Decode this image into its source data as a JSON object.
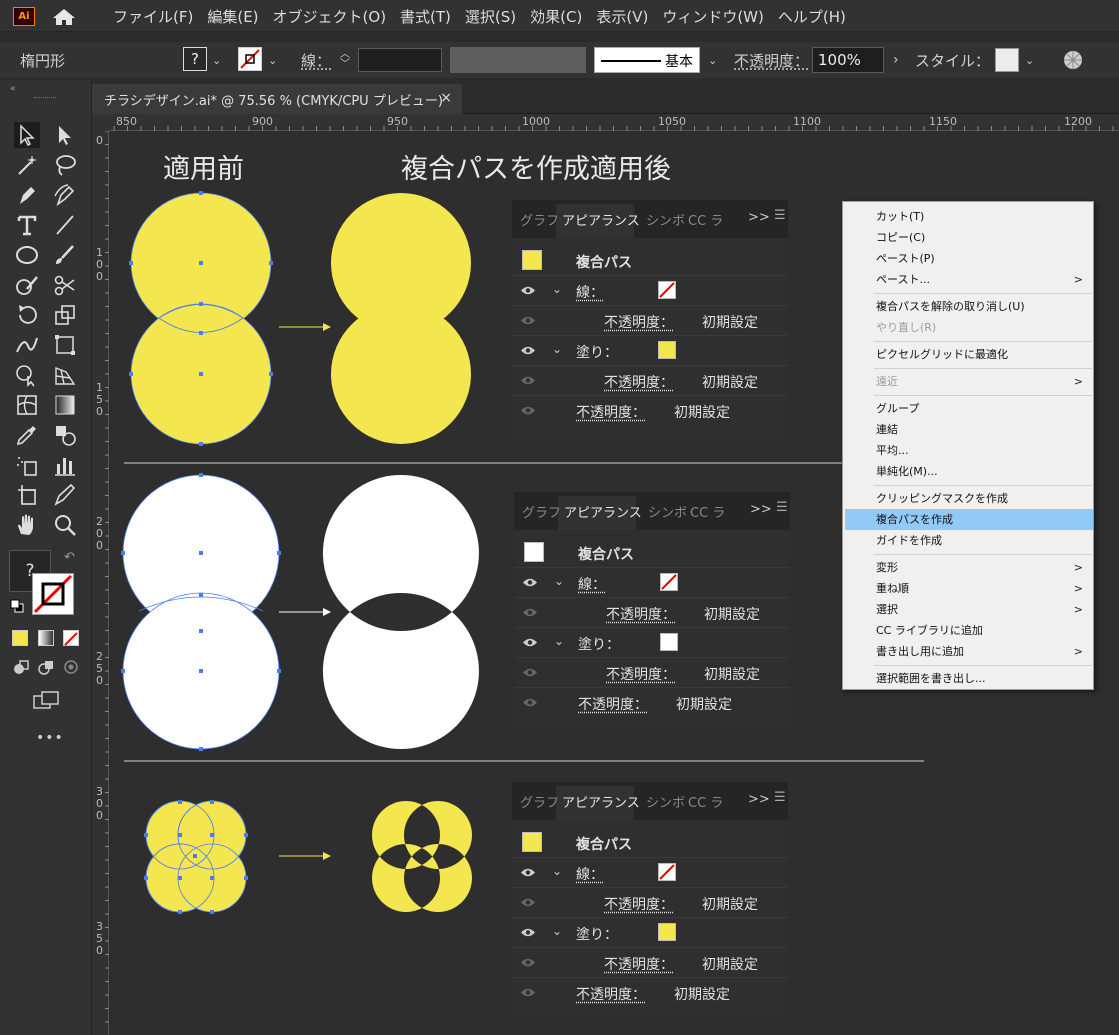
{
  "menubar": {
    "logo": "Ai",
    "items": [
      "ファイル(F)",
      "編集(E)",
      "オブジェクト(O)",
      "書式(T)",
      "選択(S)",
      "効果(C)",
      "表示(V)",
      "ウィンドウ(W)",
      "ヘルプ(H)"
    ]
  },
  "controlbar": {
    "selection_type": "楕円形",
    "fill_unknown": "?",
    "stroke_label": "線：",
    "brush_label": "基本",
    "opacity_label": "不透明度：",
    "opacity_value": "100%",
    "style_label": "スタイル："
  },
  "document_tab": {
    "title": "チラシデザイン.ai* @ 75.56 % (CMYK/CPU プレビュー)",
    "close": "×"
  },
  "ruler": {
    "top_ticks": [
      "850",
      "900",
      "950",
      "1000",
      "1050",
      "1100",
      "1150",
      "1200"
    ],
    "left_ticks": [
      [
        "0"
      ],
      [
        "1",
        "0",
        "0"
      ],
      [
        "1",
        "5",
        "0"
      ],
      [
        "2",
        "0",
        "0"
      ],
      [
        "2",
        "5",
        "0"
      ],
      [
        "3",
        "0",
        "0"
      ],
      [
        "3",
        "5",
        "0"
      ]
    ]
  },
  "toolbar": {
    "fill_unknown": "?",
    "more": "•••"
  },
  "canvas": {
    "heading_before": "適用前",
    "heading_after": "複合パスを作成適用後",
    "colors": {
      "yellow": "#f4e64e",
      "white": "#ffffff",
      "anchor": "#4a7ef0"
    }
  },
  "panel": {
    "tabs": {
      "graph": "グラフ",
      "appearance": "アピアランス",
      "symbol": "シンボ",
      "cc": "CC ラ",
      "more": ">>"
    },
    "title": "複合パス",
    "stroke_label": "線：",
    "fill_label": "塗り：",
    "opacity_label": "不透明度：",
    "opacity_value": "初期設定"
  },
  "context_menu": {
    "items": [
      {
        "label": "カット(T)",
        "state": "normal"
      },
      {
        "label": "コピー(C)",
        "state": "normal"
      },
      {
        "label": "ペースト(P)",
        "state": "normal"
      },
      {
        "label": "ペースト...",
        "state": "normal",
        "submenu": ">"
      },
      {
        "label": "複合パスを解除の取り消し(U)",
        "state": "normal"
      },
      {
        "label": "やり直し(R)",
        "state": "disabled"
      },
      {
        "label": "ピクセルグリッドに最適化",
        "state": "normal"
      },
      {
        "label": "遠近",
        "state": "disabled",
        "submenu": ">"
      },
      {
        "label": "グループ",
        "state": "normal"
      },
      {
        "label": "連結",
        "state": "normal"
      },
      {
        "label": "平均...",
        "state": "normal"
      },
      {
        "label": "単純化(M)...",
        "state": "normal"
      },
      {
        "label": "クリッピングマスクを作成",
        "state": "normal"
      },
      {
        "label": "複合パスを作成",
        "state": "highlight"
      },
      {
        "label": "ガイドを作成",
        "state": "normal"
      },
      {
        "label": "変形",
        "state": "normal",
        "submenu": ">"
      },
      {
        "label": "重ね順",
        "state": "normal",
        "submenu": ">"
      },
      {
        "label": "選択",
        "state": "normal",
        "submenu": ">"
      },
      {
        "label": "CC ライブラリに追加",
        "state": "normal"
      },
      {
        "label": "書き出し用に追加",
        "state": "normal",
        "submenu": ">"
      },
      {
        "label": "選択範囲を書き出し...",
        "state": "normal"
      }
    ]
  }
}
